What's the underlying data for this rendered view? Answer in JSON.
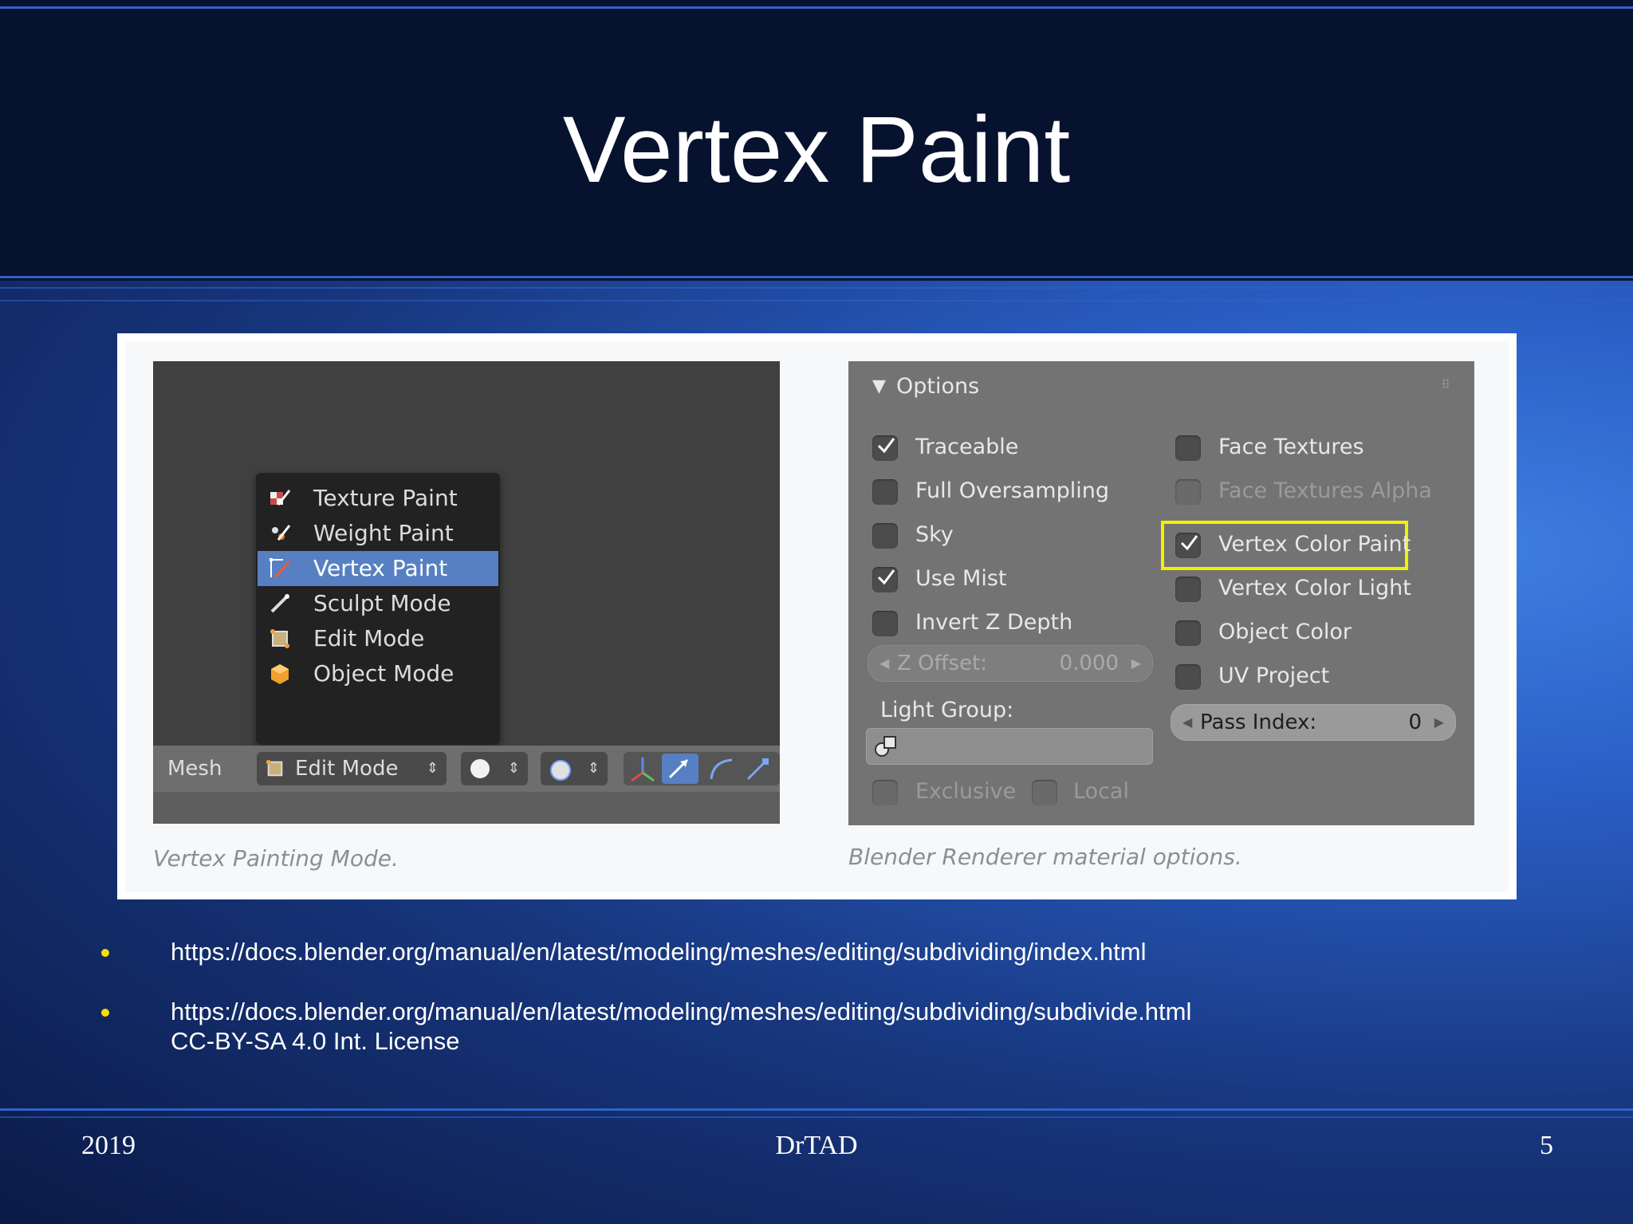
{
  "slide": {
    "title": "Vertex Paint",
    "footer_left": "2019",
    "footer_center": "DrTAD",
    "footer_right": "5"
  },
  "left_figure": {
    "caption": "Vertex Painting Mode.",
    "mode_menu": [
      {
        "label": "Texture Paint",
        "icon": "texture-paint-icon"
      },
      {
        "label": "Weight Paint",
        "icon": "weight-paint-icon"
      },
      {
        "label": "Vertex Paint",
        "icon": "vertex-paint-icon",
        "active": true
      },
      {
        "label": "Sculpt Mode",
        "icon": "sculpt-icon"
      },
      {
        "label": "Edit Mode",
        "icon": "edit-mode-icon"
      },
      {
        "label": "Object Mode",
        "icon": "object-mode-icon"
      }
    ],
    "header_bar": {
      "mesh_label": "Mesh",
      "mode_select": "Edit Mode"
    }
  },
  "right_figure": {
    "caption": "Blender Renderer material options.",
    "panel_title": "Options",
    "left_column": [
      {
        "label": "Traceable",
        "checked": true
      },
      {
        "label": "Full Oversampling",
        "checked": false
      },
      {
        "label": "Sky",
        "checked": false
      },
      {
        "label": "Use Mist",
        "checked": true
      },
      {
        "label": "Invert Z Depth",
        "checked": false
      }
    ],
    "right_column": [
      {
        "label": "Face Textures",
        "checked": false
      },
      {
        "label": "Face Textures Alpha",
        "checked": false,
        "disabled": true
      },
      {
        "label": "Vertex Color Paint",
        "checked": true,
        "highlighted": true
      },
      {
        "label": "Vertex Color Light",
        "checked": false
      },
      {
        "label": "Object Color",
        "checked": false
      },
      {
        "label": "UV Project",
        "checked": false
      }
    ],
    "z_offset": {
      "label": "Z Offset:",
      "value": "0.000"
    },
    "light_group_label": "Light Group:",
    "pass_index": {
      "label": "Pass Index:",
      "value": "0"
    },
    "exclusive_label": "Exclusive",
    "local_label": "Local",
    "highlight_color": "#f2f200"
  },
  "links": [
    "https://docs.blender.org/manual/en/latest/modeling/meshes/editing/subdividing/index.html",
    "https://docs.blender.org/manual/en/latest/modeling/meshes/editing/subdividing/subdivide.html",
    "CC-BY-SA 4.0 Int. License"
  ],
  "colors": {
    "header_bg": "#07122f",
    "bullet": "#f4e000",
    "menu_active": "#5680c2"
  }
}
